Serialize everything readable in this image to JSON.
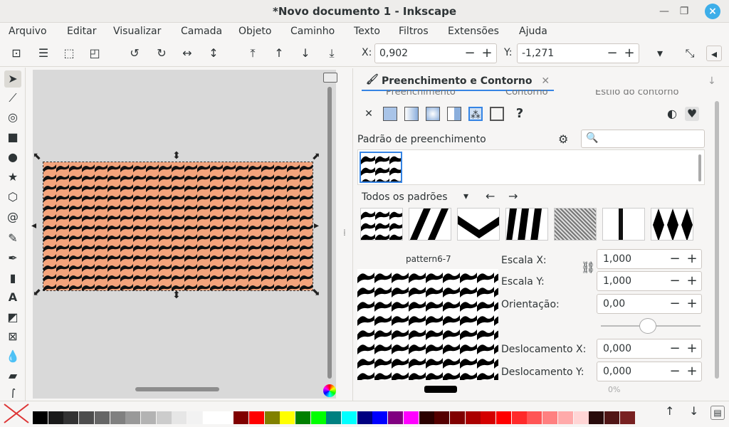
{
  "window": {
    "title": "*Novo documento 1 - Inkscape"
  },
  "menu": [
    "Arquivo",
    "Editar",
    "Visualizar",
    "Camada",
    "Objeto",
    "Caminho",
    "Texto",
    "Filtros",
    "Extensões",
    "Ajuda"
  ],
  "toolbar": {
    "x_label": "X:",
    "x_value": "0,902",
    "y_label": "Y:",
    "y_value": "-1,271"
  },
  "panel": {
    "tab_title": "Preenchimento e Contorno",
    "subtabs": [
      "Preenchimento",
      "Contorno",
      "Estilo do contorno"
    ],
    "pattern_fill_label": "Padrão de preenchimento",
    "all_patterns_label": "Todos os padrões",
    "pattern_name": "pattern6-7",
    "scale_x_label": "Escala X:",
    "scale_x_value": "1,000",
    "scale_y_label": "Escala Y:",
    "scale_y_value": "1,000",
    "orientation_label": "Orientação:",
    "orientation_value": "0,00",
    "offset_x_label": "Deslocamento X:",
    "offset_x_value": "0,000",
    "offset_y_label": "Deslocamento Y:",
    "offset_y_value": "0,000",
    "opacity_hint": "0%",
    "help_glyph": "?"
  },
  "palette_colors": [
    "#000000",
    "#1a1a1a",
    "#333333",
    "#4d4d4d",
    "#666666",
    "#808080",
    "#999999",
    "#b3b3b3",
    "#cccccc",
    "#e6e6e6",
    "#f2f2f2",
    "#ffffff",
    "#ffffff",
    "#800000",
    "#ff0000",
    "#808000",
    "#ffff00",
    "#008000",
    "#00ff00",
    "#008080",
    "#00ffff",
    "#000080",
    "#0000ff",
    "#800080",
    "#ff00ff",
    "#2b0000",
    "#550000",
    "#800000",
    "#aa0000",
    "#d40000",
    "#ff0000",
    "#ff2a2a",
    "#ff5555",
    "#ff8080",
    "#ffaaaa",
    "#ffd5d5",
    "#280b0b",
    "#501616",
    "#782121"
  ],
  "accent": "#3daee9",
  "pattern_colors": {
    "stripe_a": "#f4a47c",
    "stripe_b": "#111111"
  }
}
